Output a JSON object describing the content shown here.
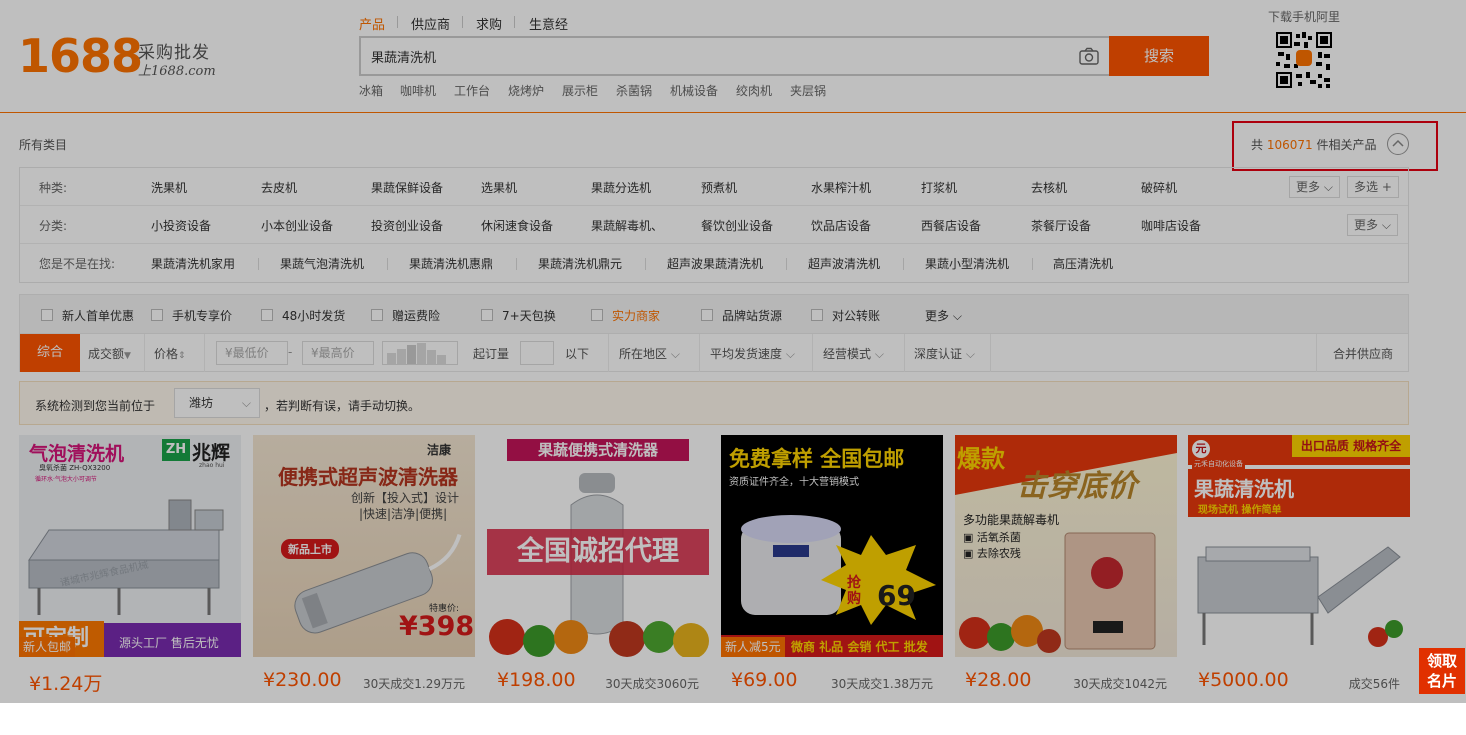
{
  "logo": {
    "number": "1688",
    "slogan1": "采购批发",
    "slogan2": "上1688.com"
  },
  "search_tabs": [
    "产品",
    "供应商",
    "求购",
    "生意经"
  ],
  "search": {
    "value": "果蔬清洗机",
    "button": "搜索"
  },
  "hot_words": [
    "冰箱",
    "咖啡机",
    "工作台",
    "烧烤炉",
    "展示柜",
    "杀菌锅",
    "机械设备",
    "绞肉机",
    "夹层锅"
  ],
  "qr": {
    "title": "下载手机阿里"
  },
  "results": {
    "all_categories": "所有类目",
    "prefix": "共",
    "count": "106071",
    "suffix": "件相关产品"
  },
  "attr_rows": [
    {
      "label": "种类:",
      "values": [
        "洗果机",
        "去皮机",
        "果蔬保鲜设备",
        "选果机",
        "果蔬分选机",
        "预煮机",
        "水果榨汁机",
        "打浆机",
        "去核机",
        "破碎机"
      ],
      "more": "更多",
      "multi": "多选"
    },
    {
      "label": "分类:",
      "values": [
        "小投资设备",
        "小本创业设备",
        "投资创业设备",
        "休闲速食设备",
        "果蔬解毒机、",
        "餐饮创业设备",
        "饮品店设备",
        "西餐店设备",
        "茶餐厅设备",
        "咖啡店设备"
      ],
      "more": "更多"
    },
    {
      "label": "您是不是在找:",
      "values": [
        "果蔬清洗机家用",
        "果蔬气泡清洗机",
        "果蔬清洗机惠鼎",
        "果蔬清洗机鼎元",
        "超声波果蔬清洗机",
        "超声波清洗机",
        "果蔬小型清洗机",
        "高压清洗机"
      ]
    }
  ],
  "checkboxes": [
    "新人首单优惠",
    "手机专享价",
    "48小时发货",
    "赠运费险",
    "7+天包换",
    "实力商家",
    "品牌站货源",
    "对公转账"
  ],
  "checkbox_more": "更多",
  "sort": {
    "active": "综合",
    "volume": "成交额",
    "price": "价格",
    "min_price": "¥最低价",
    "dash": "-",
    "max_price": "¥最高价",
    "moq_label": "起订量",
    "moq_suffix": "以下",
    "region": "所在地区",
    "shipping": "平均发货速度",
    "mode": "经营模式",
    "certify": "深度认证",
    "merge": "合并供应商"
  },
  "location": {
    "prefix": "系统检测到您当前位于",
    "city": "潍坊",
    "suffix": "，若判断有误，请手动切换。"
  },
  "products": [
    {
      "price": "¥1.24万",
      "sold": "",
      "img_title": "气泡清洗机",
      "img_brand": "兆辉",
      "img_brand_en": "zhao hui",
      "img_sub": "臭氧杀菌  ZH-QX3200",
      "img_sub2": "循环水·气泡大小可调节",
      "img_badge": "新人包邮",
      "img_bottom": "源头工厂  售后无忧",
      "img_tag": "可定制",
      "img_watermark": "诸城市兆辉食品机械"
    },
    {
      "price": "¥230.00",
      "sold": "30天成交1.29万元",
      "img_brand": "洁康",
      "img_title": "便携式超声波清洗器",
      "img_line1": "创新【投入式】设计",
      "img_line2": "|快速|洁净|便携|",
      "img_tag": "新品上市",
      "img_price_label": "特惠价:",
      "img_price": "¥398"
    },
    {
      "price": "¥198.00",
      "sold": "30天成交3060元",
      "img_title": "果蔬便携式清洗器",
      "img_mid": "全国诚招代理"
    },
    {
      "price": "¥69.00",
      "sold": "30天成交1.38万元",
      "img_title": "免费拿样 全国包邮",
      "img_sub": "资质证件齐全，十大营销模式",
      "img_burst1": "抢",
      "img_burst2": "购",
      "img_burst_num": "69",
      "img_badge": "新人减5元",
      "img_bottom": "微商 礼品 会销 代工 批发"
    },
    {
      "price": "¥28.00",
      "sold": "30天成交1042元",
      "img_title": "爆款",
      "img_title2": "击穿底价",
      "img_sub": "多功能果蔬解毒机",
      "img_list": [
        "活氧杀菌",
        "去除农残"
      ]
    },
    {
      "price": "¥5000.00",
      "sold": "成交56件",
      "img_logo": "元禾自动化设备",
      "img_top": "出口品质 规格齐全",
      "img_title": "果蔬清洗机",
      "img_sub": "现场试机 操作简单"
    }
  ],
  "coupon": {
    "line1": "领取",
    "line2": "名片"
  },
  "colors": {
    "brand": "#ff7300",
    "button": "#ff5500",
    "alert": "#e60012"
  }
}
